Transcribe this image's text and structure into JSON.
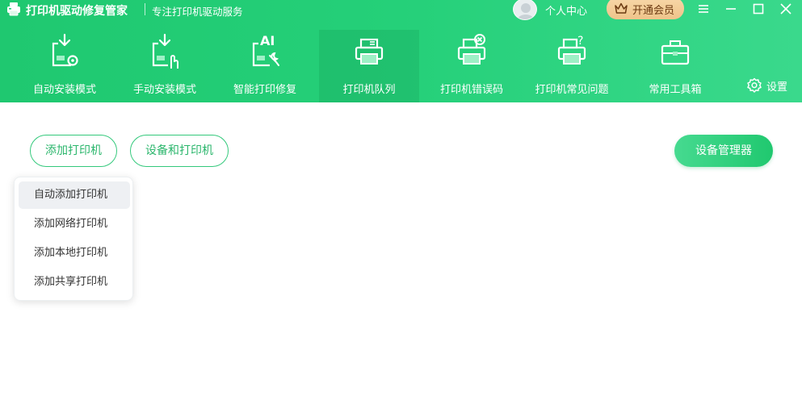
{
  "app": {
    "title": "打印机驱动修复管家",
    "subtitle": "专注打印机驱动服务",
    "user_center": "个人中心",
    "vip_label": "开通会员"
  },
  "window_controls": [
    "menu-icon",
    "minimize-icon",
    "maximize-icon",
    "close-icon"
  ],
  "nav": {
    "items": [
      {
        "label": "自动安装模式",
        "icon": "auto-install-icon"
      },
      {
        "label": "手动安装模式",
        "icon": "manual-install-icon"
      },
      {
        "label": "智能打印修复",
        "icon": "ai-repair-icon"
      },
      {
        "label": "打印机队列",
        "icon": "printer-queue-icon"
      },
      {
        "label": "打印机错误码",
        "icon": "printer-error-icon"
      },
      {
        "label": "打印机常见问题",
        "icon": "printer-faq-icon"
      },
      {
        "label": "常用工具箱",
        "icon": "toolbox-icon"
      }
    ],
    "active_index": 3,
    "settings_label": "设置"
  },
  "toolbar": {
    "add_printer": "添加打印机",
    "devices_printers": "设备和打印机",
    "device_manager": "设备管理器"
  },
  "dropdown": {
    "items": [
      "自动添加打印机",
      "添加网络打印机",
      "添加本地打印机",
      "添加共享打印机"
    ],
    "hover_index": 0
  },
  "colors": {
    "brand_green": "#25d079",
    "text_green": "#2bb66c",
    "vip_gold": "#efc48a"
  }
}
